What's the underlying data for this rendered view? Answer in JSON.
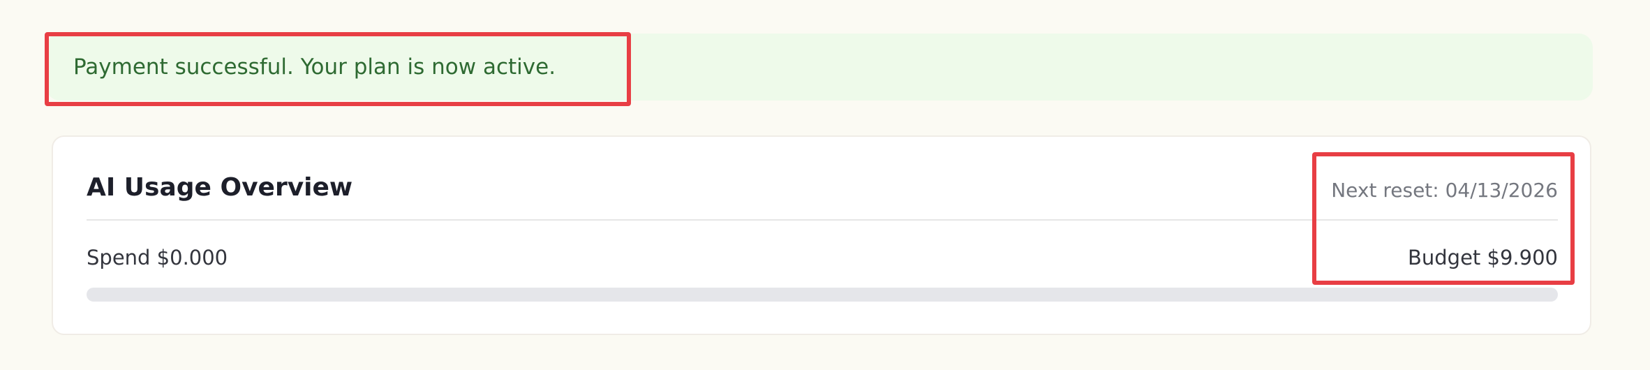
{
  "alert": {
    "message": "Payment successful. Your plan is now active."
  },
  "usage_card": {
    "title": "AI Usage Overview",
    "next_reset": "Next reset: 04/13/2026",
    "spend": "Spend $0.000",
    "budget": "Budget $9.900",
    "progress_fraction": 0.0
  },
  "colors": {
    "alert_bg": "#eefaea",
    "alert_text": "#2e6a32",
    "highlight": "#e83e44",
    "progress_track": "#e5e6ea"
  }
}
